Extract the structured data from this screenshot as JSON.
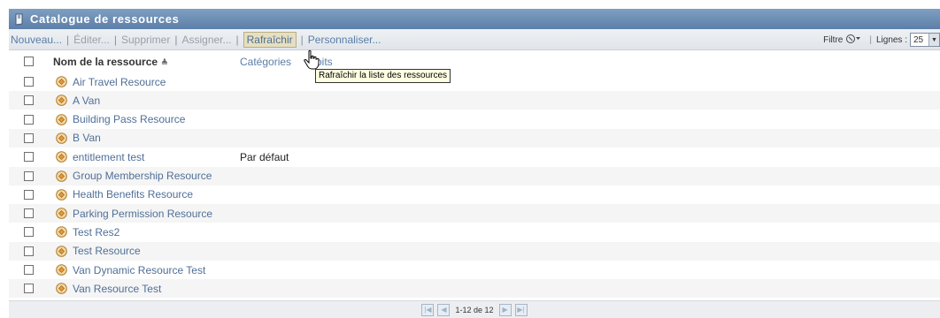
{
  "window": {
    "title": "Catalogue de ressources"
  },
  "toolbar": {
    "new_label": "Nouveau...",
    "edit_label": "Éditer...",
    "delete_label": "Supprimer",
    "assign_label": "Assigner...",
    "refresh_label": "Rafraîchir",
    "customize_label": "Personnaliser...",
    "filter_label": "Filtre",
    "rows_label": "Lignes :",
    "rows_value": "25"
  },
  "columns": {
    "name": "Nom de la ressource",
    "categories": "Catégories",
    "rights": "Droits",
    "rights_visible": "oits"
  },
  "tooltip": "Rafraîchir la liste des ressources",
  "rows": [
    {
      "name": "Air Travel Resource",
      "category": ""
    },
    {
      "name": "A Van",
      "category": ""
    },
    {
      "name": "Building Pass Resource",
      "category": ""
    },
    {
      "name": "B Van",
      "category": ""
    },
    {
      "name": "entitlement test",
      "category": "Par défaut"
    },
    {
      "name": "Group Membership Resource",
      "category": ""
    },
    {
      "name": "Health Benefits Resource",
      "category": ""
    },
    {
      "name": "Parking Permission Resource",
      "category": ""
    },
    {
      "name": "Test Res2",
      "category": ""
    },
    {
      "name": "Test Resource",
      "category": ""
    },
    {
      "name": "Van Dynamic Resource Test",
      "category": ""
    },
    {
      "name": "Van Resource Test",
      "category": ""
    }
  ],
  "pagination": {
    "text": "1-12 de 12"
  },
  "colors": {
    "title_bar": "#6f8fb5",
    "link": "#4f6f97",
    "tooltip_bg": "#ffffe1"
  },
  "icons": [
    "resource-icon",
    "filter-icon",
    "sort-asc-icon",
    "first-page-icon",
    "prev-page-icon",
    "next-page-icon",
    "last-page-icon",
    "hand-cursor-icon"
  ]
}
